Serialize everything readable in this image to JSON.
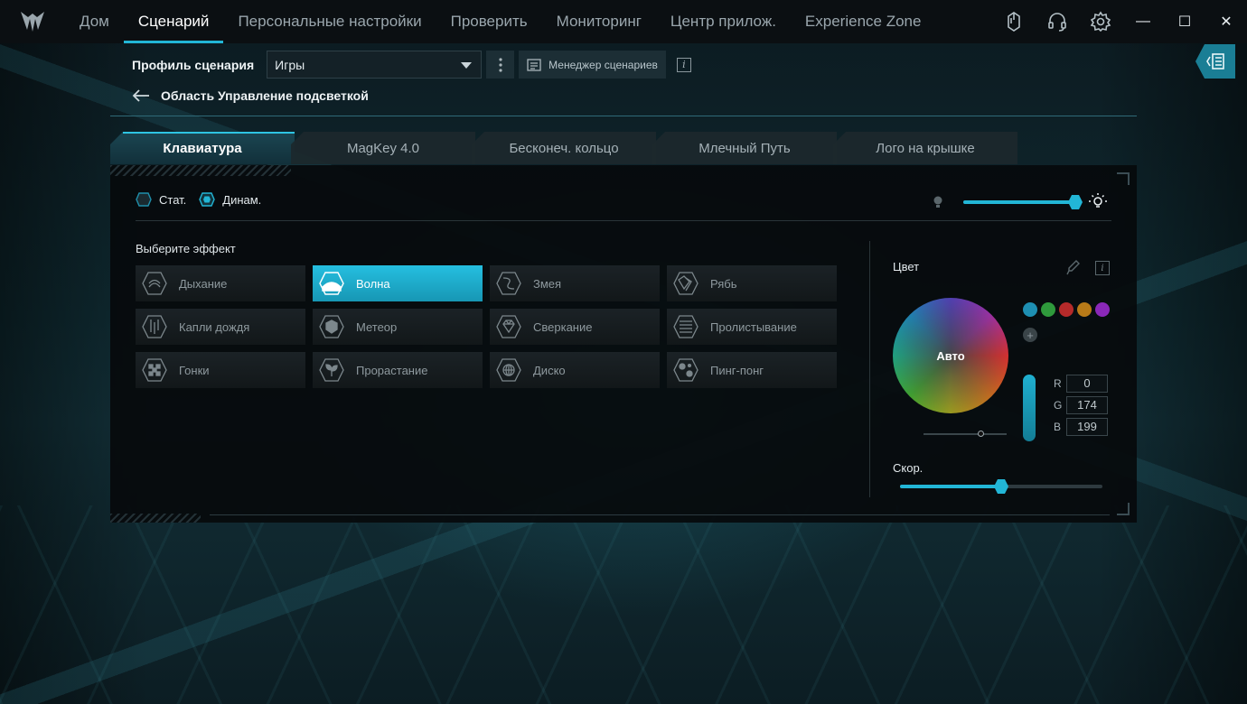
{
  "nav": {
    "items": [
      "Дом",
      "Сценарий",
      "Персональные настройки",
      "Проверить",
      "Мониторинг",
      "Центр прилож.",
      "Experience Zone"
    ],
    "active_index": 1
  },
  "topbar_icons": [
    "mouse-icon",
    "headset-icon",
    "gear-icon"
  ],
  "window": {
    "minimize": "—",
    "maximize": "☐",
    "close": "✕"
  },
  "profile": {
    "label": "Профиль сценария",
    "selected": "Игры",
    "manager_label": "Менеджер сценариев",
    "info": "i"
  },
  "breadcrumb": {
    "title": "Область Управление подсветкой"
  },
  "tabs": [
    "Клавиатура",
    "MagKey 4.0",
    "Бесконеч. кольцо",
    "Млечный Путь",
    "Лого на крышке"
  ],
  "active_tab": 0,
  "mode": {
    "static_label": "Стат.",
    "dynamic_label": "Динам.",
    "selected": "dynamic"
  },
  "brightness": {
    "value_fraction": 1.0
  },
  "effects": {
    "title": "Выберите эффект",
    "items": [
      "Дыхание",
      "Волна",
      "Змея",
      "Рябь",
      "Капли дождя",
      "Метеор",
      "Сверкание",
      "Пролистывание",
      "Гонки",
      "Прорастание",
      "Диско",
      "Пинг-понг"
    ],
    "active_index": 1
  },
  "color": {
    "title": "Цвет",
    "wheel_label": "Авто",
    "info": "i",
    "swatches": [
      "#1ea6c8",
      "#2fb040",
      "#d43030",
      "#d68a1a",
      "#9a2fd0"
    ],
    "add": "+",
    "r_label": "R",
    "r": "0",
    "g_label": "G",
    "g": "174",
    "b_label": "B",
    "b": "199"
  },
  "speed": {
    "title": "Скор.",
    "value_fraction": 0.5
  },
  "accent": "#22b6d6"
}
